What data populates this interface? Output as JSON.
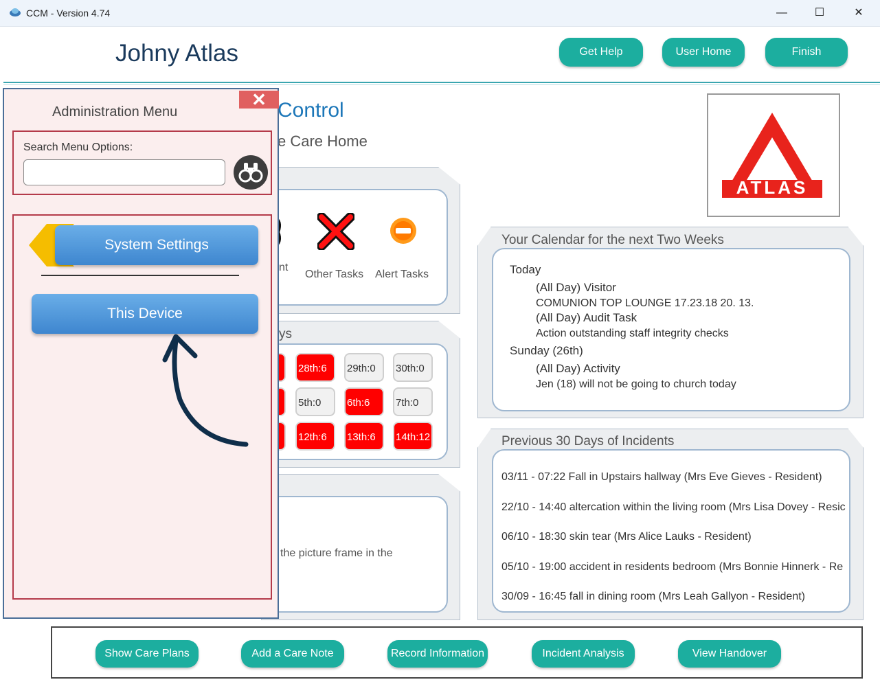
{
  "window": {
    "title": "CCM - Version 4.74",
    "controls": {
      "minimize": "—",
      "maximize": "☐",
      "close": "✕"
    }
  },
  "header": {
    "user_name": "Johny Atlas",
    "buttons": {
      "get_help": "Get Help",
      "user_home": "User Home",
      "finish": "Finish"
    }
  },
  "dashboard": {
    "title_partial": "Control",
    "subtitle_partial": "e Care Home",
    "logo_text": "ATLAS",
    "tasks": {
      "partial_label": "nt",
      "other_tasks": "Other Tasks",
      "alert_tasks": "Alert Tasks"
    },
    "days_partial_title": "ys",
    "day_cells": [
      {
        "label": "28th:6",
        "status": "red"
      },
      {
        "label": "29th:0",
        "status": "gray"
      },
      {
        "label": "30th:0",
        "status": "gray"
      },
      {
        "label": "5th:0",
        "status": "gray"
      },
      {
        "label": "6th:6",
        "status": "red"
      },
      {
        "label": "7th:0",
        "status": "gray"
      },
      {
        "label": "12th:6",
        "status": "red"
      },
      {
        "label": "13th:6",
        "status": "red"
      },
      {
        "label": "14th:12",
        "status": "red"
      }
    ],
    "picture_frame_partial": "the picture frame in the"
  },
  "calendar": {
    "title": "Your Calendar for the next Two Weeks",
    "entries": {
      "today": "Today",
      "e1": "(All Day) Visitor",
      "e2": "COMUNION TOP LOUNGE 17.23.18 20. 13.",
      "e3": "(All Day) Audit Task",
      "e4": "Action outstanding staff integrity checks",
      "sunday": "Sunday (26th)",
      "e5": "(All Day) Activity",
      "e6": "Jen (18) will not be going to church today"
    }
  },
  "incidents": {
    "title": "Previous 30 Days of Incidents",
    "items": [
      "03/11 - 07:22  Fall in Upstairs hallway (Mrs Eve Gieves - Resident)",
      "22/10 - 14:40  altercation within the living room (Mrs Lisa Dovey - Resic",
      "06/10 - 18:30  skin tear (Mrs Alice Lauks - Resident)",
      "05/10 - 19:00  accident in residents bedroom (Mrs Bonnie Hinnerk - Re",
      "30/09 - 16:45  fall in dining room (Mrs Leah Gallyon - Resident)"
    ]
  },
  "admin_menu": {
    "title": "Administration Menu",
    "close_label": "✕",
    "search_label": "Search Menu Options:",
    "search_value": "",
    "system_settings": "System Settings",
    "this_device": "This Device"
  },
  "bottom_bar": {
    "show_care_plans": "Show Care Plans",
    "add_care_note": "Add a Care Note",
    "record_information": "Record Information",
    "incident_analysis": "Incident Analysis",
    "view_handover": "View Handover"
  },
  "colors": {
    "teal_button": "#1cae9f",
    "blue_button": "#4a90d9",
    "red_cell": "#ff0000",
    "menu_bg": "#fbeeee",
    "menu_border": "#b43a4a",
    "title_blue": "#1b76b8",
    "arrow": "#0f2e4a"
  }
}
